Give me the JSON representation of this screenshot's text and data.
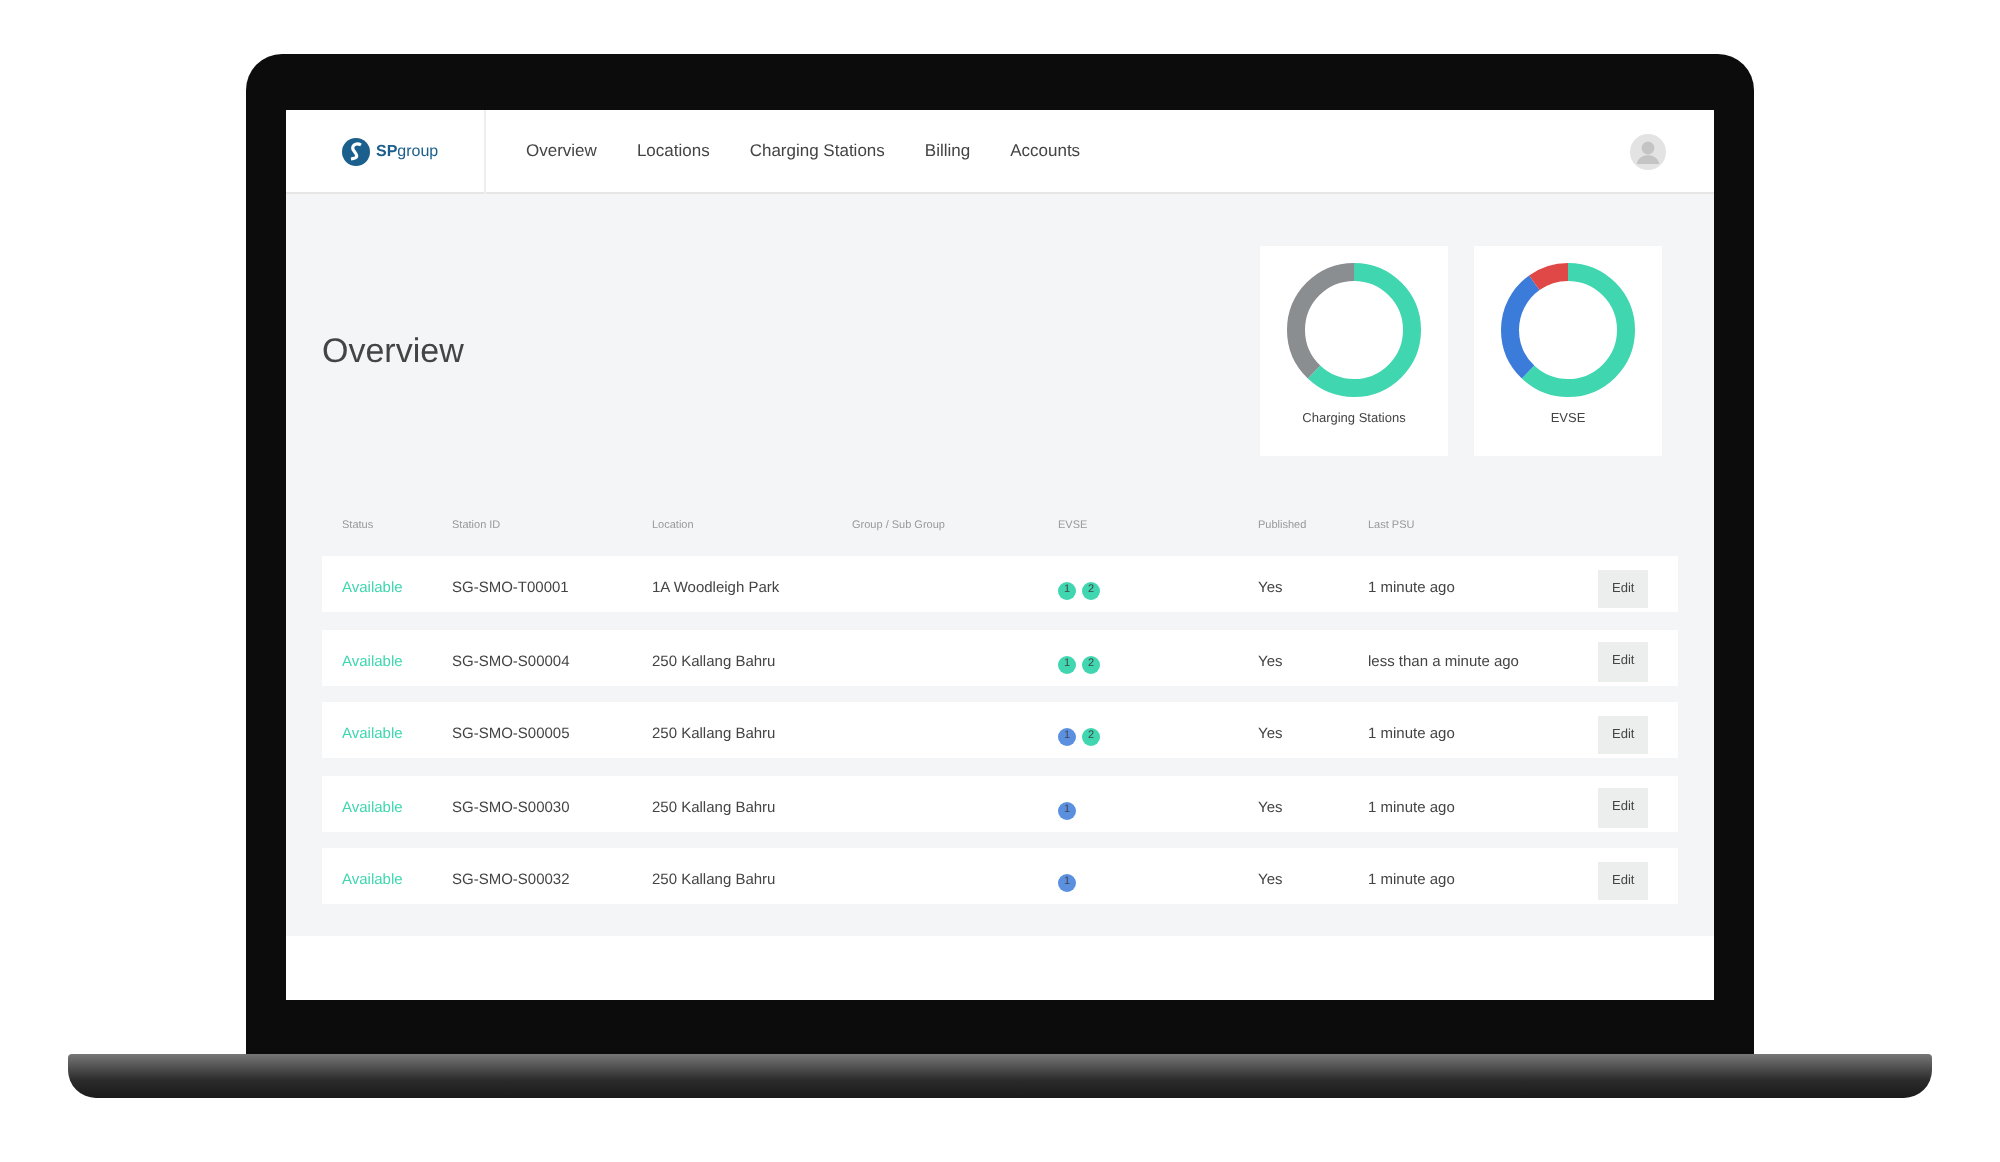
{
  "brand": "**SP**group",
  "nav": [
    {
      "label": "Overview",
      "selected": false
    },
    {
      "label": "Locations",
      "selected": false
    },
    {
      "label": "Charging Stations",
      "selected": false
    },
    {
      "label": "Billing",
      "selected": false
    },
    {
      "label": "Accounts",
      "selected": false
    }
  ],
  "title": "Overview",
  "charts": [
    {
      "label": "Charging Stations"
    },
    {
      "label": "EVSE"
    }
  ],
  "table": {
    "columns": [
      "Status",
      "Station ID",
      "Location",
      "Group / Sub Group",
      "EVSE",
      "Published",
      "Last PSU"
    ],
    "rows": [
      {
        "status": "Available",
        "station_id": "SG-SMO-T00001",
        "location": "1A Woodleigh Park",
        "evse": [
          {
            "label": "1",
            "color": "#3fd6b0"
          },
          {
            "label": "2",
            "color": "#3fd6b0"
          }
        ],
        "published": "Yes",
        "last": "1 minute ago",
        "action": "Edit"
      },
      {
        "status": "Available",
        "station_id": "SG-SMO-S00004",
        "location": "250 Kallang Bahru",
        "evse": [
          {
            "label": "1",
            "color": "#3fd6b0"
          },
          {
            "label": "2",
            "color": "#3fd6b0"
          }
        ],
        "published": "Yes",
        "last": "less than a minute ago",
        "action": "Edit"
      },
      {
        "status": "Available",
        "station_id": "SG-SMO-S00005",
        "location": "250 Kallang Bahru",
        "evse": [
          {
            "label": "1",
            "color": "#5b8fe0"
          },
          {
            "label": "2",
            "color": "#3fd6b0"
          }
        ],
        "published": "Yes",
        "last": "1 minute ago",
        "action": "Edit"
      },
      {
        "status": "Available",
        "station_id": "SG-SMO-S00030",
        "location": "250 Kallang Bahru",
        "evse": [
          {
            "label": "1",
            "color": "#5b8fe0"
          }
        ],
        "published": "Yes",
        "last": "1 minute ago",
        "action": "Edit"
      },
      {
        "status": "Available",
        "station_id": "SG-SMO-S00032",
        "location": "250 Kallang Bahru",
        "evse": [
          {
            "label": "1",
            "color": "#5b8fe0"
          }
        ],
        "published": "Yes",
        "last": "1 minute ago",
        "action": "Edit"
      }
    ]
  }
}
